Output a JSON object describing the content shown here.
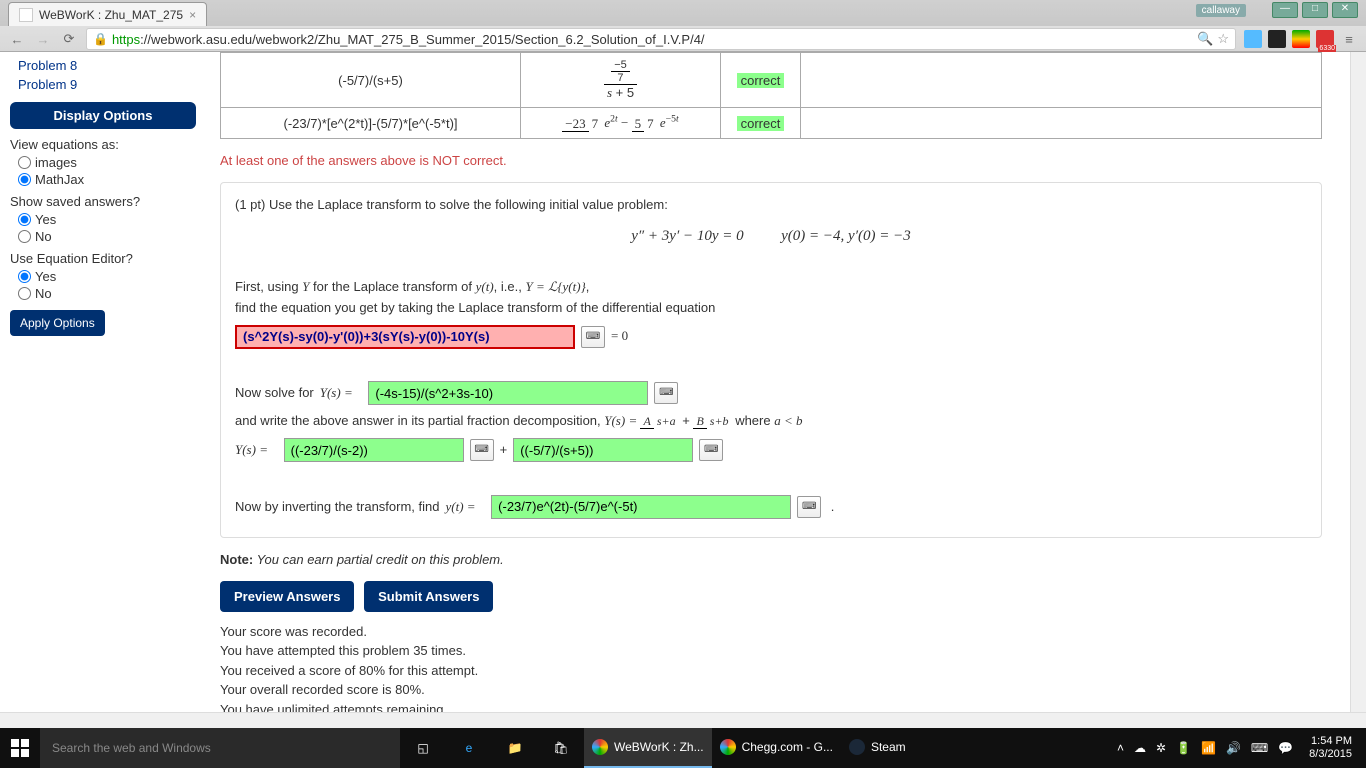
{
  "window": {
    "user_badge": "callaway",
    "tab_title": "WeBWorK : Zhu_MAT_275",
    "url_scheme": "https",
    "url_rest": "://webwork.asu.edu/webwork2/Zhu_MAT_275_B_Summer_2015/Section_6.2_Solution_of_I.V.P/4/",
    "gmail_badge": "6330"
  },
  "sidebar": {
    "problems": [
      "Problem 8",
      "Problem 9"
    ],
    "heading": "Display Options",
    "view_label": "View equations as:",
    "view_options": [
      "images",
      "MathJax"
    ],
    "saved_label": "Show saved answers?",
    "saved_options": [
      "Yes",
      "No"
    ],
    "eq_editor_label": "Use Equation Editor?",
    "eq_editor_options": [
      "Yes",
      "No"
    ],
    "apply": "Apply Options"
  },
  "results": {
    "rows": [
      {
        "entered": "(-5/7)/(s+5)",
        "status": "correct"
      },
      {
        "entered": "(-23/7)*[e^(2*t)]-(5/7)*[e^(-5*t)]",
        "status": "correct"
      }
    ]
  },
  "error": "At least one of the answers above is NOT correct.",
  "problem": {
    "pt_label": "(1 pt) Use the Laplace transform to solve the following initial value problem:",
    "eq_left": "y″ + 3y′ − 10y = 0",
    "eq_right": "y(0) = −4,  y′(0) = −3",
    "first_line1": "First, using ",
    "first_line2": " for the Laplace transform of ",
    "first_line3": ", i.e., ",
    "first_line4": ",",
    "second_line": "find the equation you get by taking the Laplace transform of the differential equation",
    "ans1": "(s^2Y(s)-sy(0)-y'(0))+3(sY(s)-y(0))-10Y(s)",
    "eq_zero": " = 0",
    "solve_label": "Now solve for ",
    "ans2": "(-4s-15)/(s^2+3s-10)",
    "pfd_line": "and write the above answer in its partial fraction decomposition, ",
    "pfd_where": " where ",
    "ans3": "((-23/7)/(s-2))",
    "plus": " + ",
    "ans4": "((-5/7)/(s+5))",
    "invert_label": "Now by inverting the transform, find ",
    "ans5": "(-23/7)e^(2t)-(5/7)e^(-5t)"
  },
  "note_label": "Note:",
  "note_text": " You can earn partial credit on this problem.",
  "buttons": {
    "preview": "Preview Answers",
    "submit": "Submit Answers"
  },
  "score": [
    "Your score was recorded.",
    "You have attempted this problem 35 times.",
    "You received a score of 80% for this attempt.",
    "Your overall recorded score is 80%.",
    "You have unlimited attempts remaining."
  ],
  "taskbar": {
    "search_placeholder": "Search the web and Windows",
    "apps": [
      {
        "label": "WeBWorK : Zh...",
        "icon": "chrome"
      },
      {
        "label": "Chegg.com - G...",
        "icon": "chrome"
      },
      {
        "label": "Steam",
        "icon": "steam"
      }
    ],
    "time": "1:54 PM",
    "date": "8/3/2015"
  }
}
